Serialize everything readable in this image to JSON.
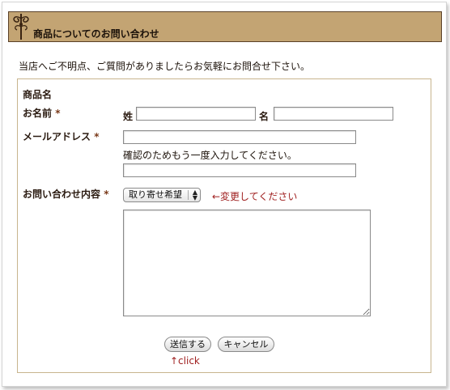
{
  "header": {
    "title": "商品についてのお問い合わせ"
  },
  "intro": "当店へご不明点、ご質問がありましたらお気軽にお問合せ下さい。",
  "form": {
    "product_label": "商品名",
    "name_label": "お名前",
    "required_mark": "*",
    "last_name_label": "姓",
    "first_name_label": "名",
    "last_name_value": "",
    "first_name_value": "",
    "email_label": "メールアドレス",
    "email_value": "",
    "email_confirm_note": "確認のためもう一度入力してください。",
    "email_confirm_value": "",
    "inquiry_label": "お問い合わせ内容",
    "inquiry_select_value": "取り寄せ希望",
    "change_hint": "←変更してください",
    "message_value": ""
  },
  "buttons": {
    "submit_label": "送信する",
    "cancel_label": "キャンセル"
  },
  "click_hint": "↑click",
  "colors": {
    "header_bg": "#c3a473",
    "hint_red": "#a02020",
    "box_border": "#c8b58e"
  }
}
